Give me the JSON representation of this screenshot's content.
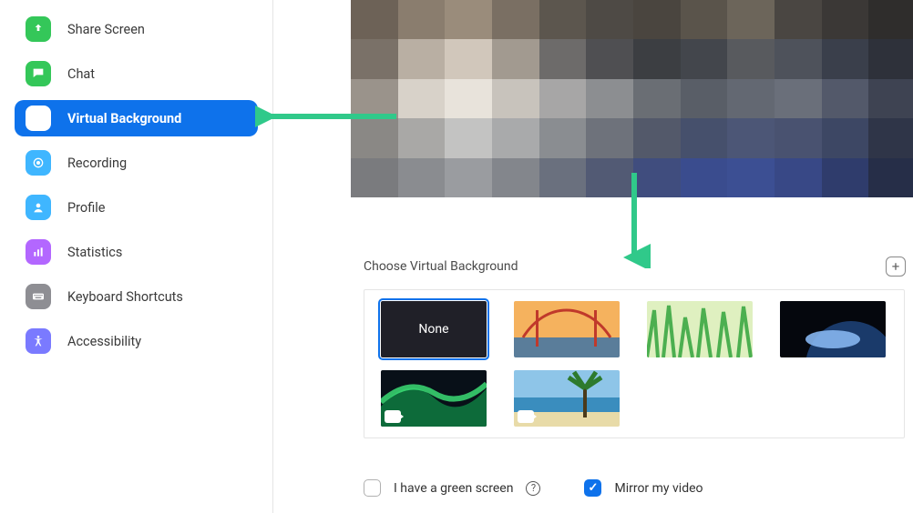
{
  "sidebar": {
    "items": [
      {
        "id": "share-screen",
        "label": "Share Screen",
        "icon": "share-upload-icon",
        "color": "#34c759",
        "active": false
      },
      {
        "id": "chat",
        "label": "Chat",
        "icon": "chat-bubble-icon",
        "color": "#34c759",
        "active": false
      },
      {
        "id": "virtual-bg",
        "label": "Virtual Background",
        "icon": "person-card-icon",
        "color": "#0e72eb",
        "active": true
      },
      {
        "id": "recording",
        "label": "Recording",
        "icon": "record-icon",
        "color": "#3fb6ff",
        "active": false
      },
      {
        "id": "profile",
        "label": "Profile",
        "icon": "person-icon",
        "color": "#3fb6ff",
        "active": false
      },
      {
        "id": "statistics",
        "label": "Statistics",
        "icon": "bar-chart-icon",
        "color": "#b367ff",
        "active": false
      },
      {
        "id": "keyboard",
        "label": "Keyboard Shortcuts",
        "icon": "keyboard-icon",
        "color": "#8e8e93",
        "active": false
      },
      {
        "id": "accessibility",
        "label": "Accessibility",
        "icon": "accessibility-icon",
        "color": "#7a7aff",
        "active": false
      }
    ]
  },
  "main": {
    "section_title": "Choose Virtual Background",
    "add_button_label": "+",
    "thumbs": [
      {
        "id": "none",
        "label": "None",
        "selected": true
      },
      {
        "id": "bridge",
        "selected": false
      },
      {
        "id": "grass",
        "selected": false
      },
      {
        "id": "earth",
        "selected": false
      },
      {
        "id": "aurora",
        "selected": false,
        "video": true
      },
      {
        "id": "beach",
        "selected": false,
        "video": true
      }
    ],
    "options": {
      "green_screen_label": "I have a green screen",
      "green_screen_checked": false,
      "mirror_label": "Mirror my video",
      "mirror_checked": true
    }
  },
  "annotations": {
    "arrow_color": "#30c98a"
  }
}
